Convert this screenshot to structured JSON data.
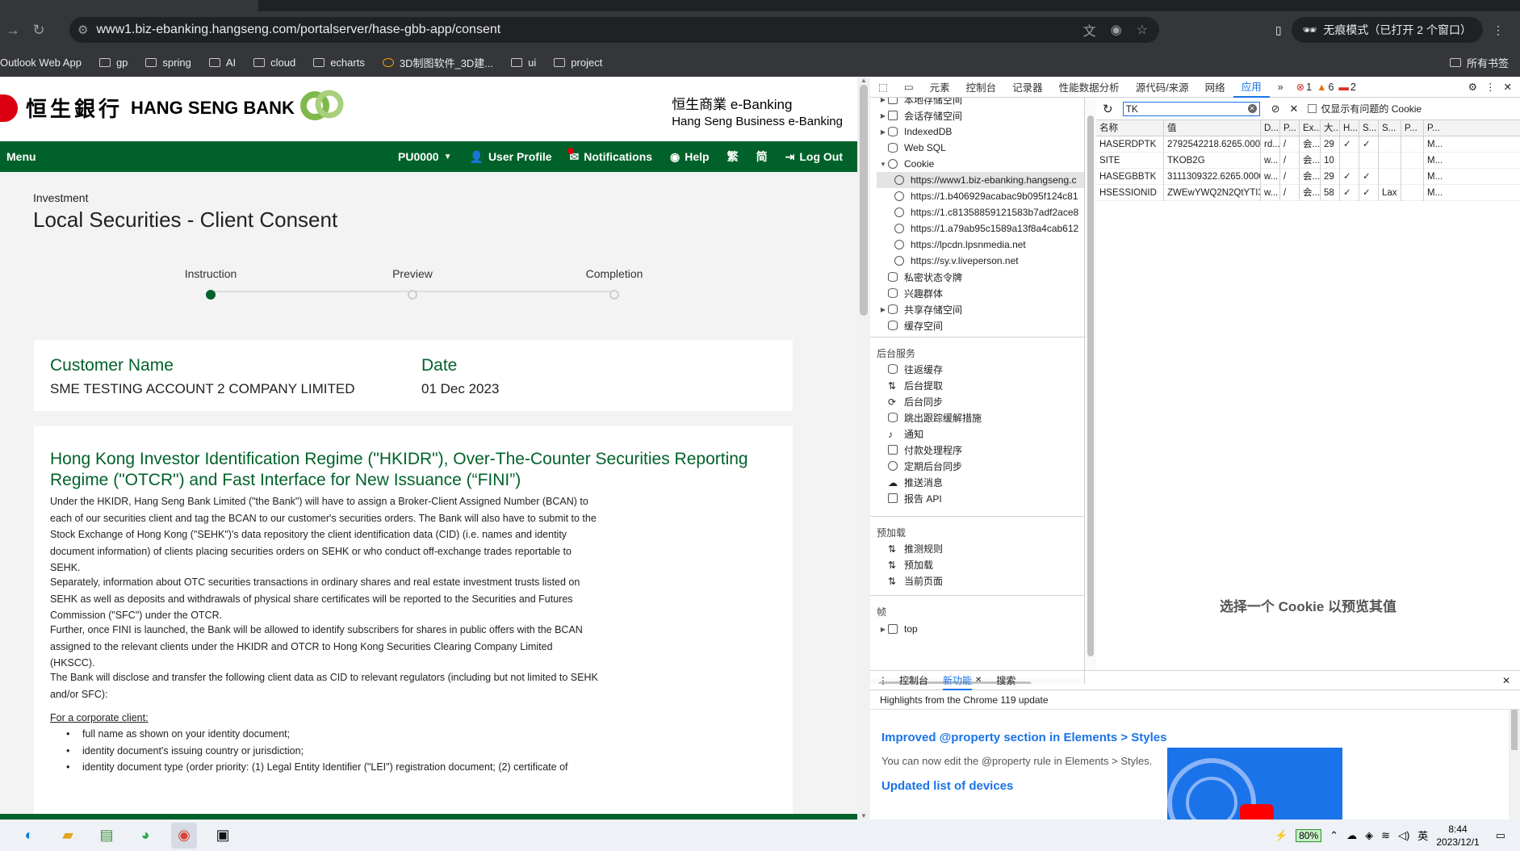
{
  "browser": {
    "url": "www1.biz-ebanking.hangseng.com/portalserver/hase-gbb-app/consent",
    "incognito_label": "无痕模式（已打开 2 个窗口）",
    "bookmarks": [
      "Outlook Web App",
      "gp",
      "spring",
      "AI",
      "cloud",
      "echarts",
      "3D制图软件_3D建...",
      "ui",
      "project"
    ],
    "all_bookmarks": "所有书签"
  },
  "bank": {
    "logo_cn": "恒生銀行",
    "logo_en": "HANG SENG BANK",
    "ebank_cn": "恒生商業 e-Banking",
    "ebank_en": "Hang Seng Business e-Banking"
  },
  "nav": {
    "menu": "Menu",
    "account": "PU0000",
    "user_profile": "User Profile",
    "notifications": "Notifications",
    "help": "Help",
    "lang_trad": "繁",
    "lang_simp": "简",
    "logout": "Log Out"
  },
  "page": {
    "breadcrumb": "Investment",
    "title": "Local Securities - Client Consent",
    "steps": [
      "Instruction",
      "Preview",
      "Completion"
    ],
    "active_step": 0,
    "customer_label": "Customer Name",
    "customer_value": "SME TESTING ACCOUNT 2 COMPANY LIMITED",
    "date_label": "Date",
    "date_value": "01 Dec 2023",
    "heading": "Hong Kong Investor Identification Regime (\"HKIDR\"), Over-The-Counter Securities Reporting Regime (\"OTCR\") and Fast Interface for New Issuance (“FINI”)",
    "para1": "Under the HKIDR, Hang Seng Bank Limited (\"the Bank\") will have to assign a Broker-Client Assigned Number (BCAN) to each of our securities client and tag the BCAN to our customer's securities orders. The Bank will also have to submit to the Stock Exchange of Hong Kong (\"SEHK\")'s data repository the client identification data (CID) (i.e. names and identity document information) of clients placing securities orders on SEHK or who conduct off-exchange trades reportable to SEHK.",
    "para2": "Separately, information about OTC securities transactions in ordinary shares and real estate investment trusts listed on SEHK as well as deposits and withdrawals of physical share certificates will be reported to the Securities and Futures Commission (\"SFC\") under the OTCR.",
    "para3": "Further, once FINI is launched, the Bank will be allowed to identify subscribers for shares in public offers with the BCAN assigned to the relevant clients under the HKIDR and OTCR to Hong Kong Securities Clearing Company Limited (HKSCC).",
    "para4": "The Bank will disclose and transfer the following client data as CID to relevant regulators (including but not limited to SEHK and/or SFC):",
    "corp_label": "For a corporate client:",
    "bullets": [
      "full name as shown on your identity document;",
      "identity document's issuing country or jurisdiction;",
      "identity document type (order priority: (1) Legal Entity Identifier (\"LEI\") registration document; (2) certificate of"
    ]
  },
  "devtools": {
    "tabs": [
      "元素",
      "控制台",
      "记录器",
      "性能数据分析",
      "源代码/来源",
      "网络",
      "应用"
    ],
    "active_tab": "应用",
    "errors": "1",
    "warnings": "6",
    "issues": "2",
    "tree": {
      "top_partial": "本地存储空间",
      "session_storage": "会话存储空间",
      "indexeddb": "IndexedDB",
      "websql": "Web SQL",
      "cookie": "Cookie",
      "cookie_items": [
        "https://www1.biz-ebanking.hangseng.c",
        "https://1.b406929acabac9b095f124c81",
        "https://1.c81358859121583b7adf2ace8",
        "https://1.a79ab95c1589a13f8a4cab612",
        "https://lpcdn.lpsnmedia.net",
        "https://sy.v.liveperson.net"
      ],
      "private_tokens": "私密状态令牌",
      "interest_groups": "兴趣群体",
      "shared_storage": "共享存储空间",
      "cache_storage": "缓存空间",
      "background_title": "后台服务",
      "background": [
        "往返缓存",
        "后台提取",
        "后台同步",
        "跳出跟踪缓解措施",
        "通知",
        "付款处理程序",
        "定期后台同步",
        "推送消息",
        "报告 API"
      ],
      "preload_title": "预加载",
      "preload": [
        "推测规则",
        "预加载",
        "当前页面"
      ],
      "frames_title": "帧",
      "frames_top": "top"
    },
    "filter_value": "TK",
    "only_issues_label": "仅显示有问题的 Cookie",
    "columns": [
      "名称",
      "值",
      "D...",
      "P...",
      "Ex...",
      "大...",
      "H...",
      "S...",
      "S...",
      "P...",
      "P..."
    ],
    "cookies": [
      {
        "name": "HASERDPTK",
        "value": "2792542218.6265.0000",
        "domain": "rd...",
        "path": "/",
        "exp": "会...",
        "size": "29",
        "http": "✓",
        "secure": "✓",
        "same": "",
        "p": "",
        "pr": "M..."
      },
      {
        "name": "SITE",
        "value": "TKOB2G",
        "domain": "w...",
        "path": "/",
        "exp": "会...",
        "size": "10",
        "http": "",
        "secure": "",
        "same": "",
        "p": "",
        "pr": "M..."
      },
      {
        "name": "HASEGBBTK",
        "value": "3111309322.6265.0000",
        "domain": "w...",
        "path": "/",
        "exp": "会...",
        "size": "29",
        "http": "✓",
        "secure": "✓",
        "same": "",
        "p": "",
        "pr": "M..."
      },
      {
        "name": "HSESSIONID",
        "value": "ZWEwYWQ2N2QtYTI3Y...",
        "domain": "w...",
        "path": "/",
        "exp": "会...",
        "size": "58",
        "http": "✓",
        "secure": "✓",
        "same": "Lax",
        "p": "",
        "pr": "M..."
      }
    ],
    "preview_text": "选择一个 Cookie 以预览其值",
    "drawer_tabs": [
      "控制台",
      "新功能",
      "搜索"
    ],
    "drawer_active": "新功能",
    "highlights": "Highlights from the Chrome 119 update",
    "feature1_title": "Improved @property section in Elements > Styles",
    "feature1_text": "You can now edit the @property rule in Elements > Styles.",
    "feature2_title": "Updated list of devices"
  },
  "taskbar": {
    "battery": "80%",
    "ime": "英",
    "time": "8:44",
    "date": "2023/12/1"
  },
  "colors": {
    "bank_green": "#00622a",
    "bank_red": "#db0011",
    "devtools_blue": "#1a73e8"
  }
}
